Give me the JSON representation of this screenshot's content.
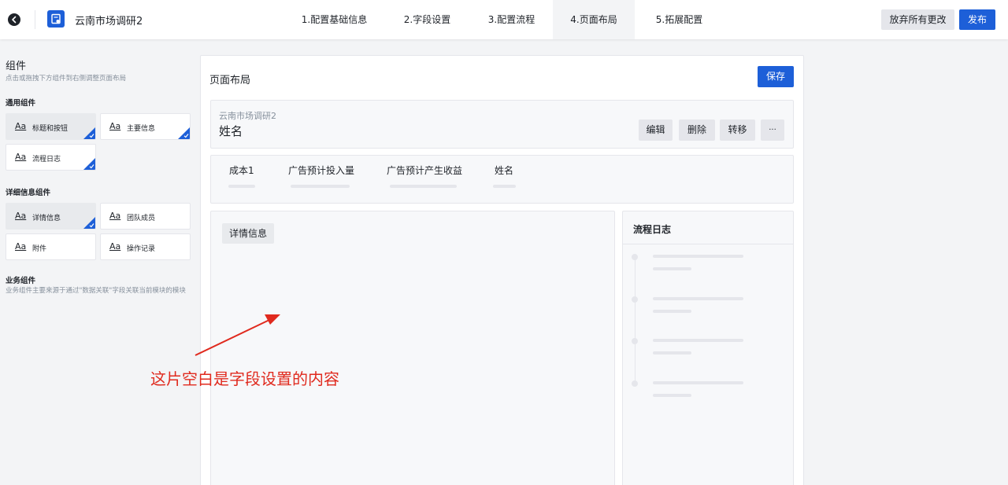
{
  "topbar": {
    "app_title": "云南市场调研2",
    "steps": [
      "1.配置基础信息",
      "2.字段设置",
      "3.配置流程",
      "4.页面布局",
      "5.拓展配置"
    ],
    "active_step": "4.页面布局",
    "discard_label": "放弃所有更改",
    "publish_label": "发布"
  },
  "sidebar": {
    "title": "组件",
    "hint": "点击或拖拽下方组件到右侧调整页面布局",
    "general": {
      "heading": "通用组件",
      "items": [
        {
          "label": "标题和按钮",
          "selected": true
        },
        {
          "label": "主要信息",
          "selected": false
        },
        {
          "label": "流程日志",
          "selected": false
        }
      ]
    },
    "detail": {
      "heading": "详细信息组件",
      "items": [
        {
          "label": "详情信息",
          "selected": true
        },
        {
          "label": "团队成员",
          "selected": false
        },
        {
          "label": "附件",
          "selected": false
        },
        {
          "label": "操作记录",
          "selected": false
        }
      ]
    },
    "business": {
      "heading": "业务组件",
      "description": "业务组件主要来源于通过\"数据关联\"字段关联当前模块的模块"
    },
    "aa_glyph": "Aa"
  },
  "canvas": {
    "title": "页面布局",
    "save_label": "保存",
    "header_card": {
      "subtitle": "云南市场调研2",
      "title": "姓名",
      "buttons": [
        "编辑",
        "删除",
        "转移",
        "···"
      ]
    },
    "summary_fields": [
      "成本1",
      "广告预计投入量",
      "广告预计产生收益",
      "姓名"
    ],
    "detail_tag": "详情信息",
    "log_title": "流程日志"
  },
  "annotation": {
    "text": "这片空白是字段设置的内容",
    "color": "#e02a1e"
  },
  "colors": {
    "accent": "#1d5fd8",
    "background": "#f3f4f6"
  }
}
